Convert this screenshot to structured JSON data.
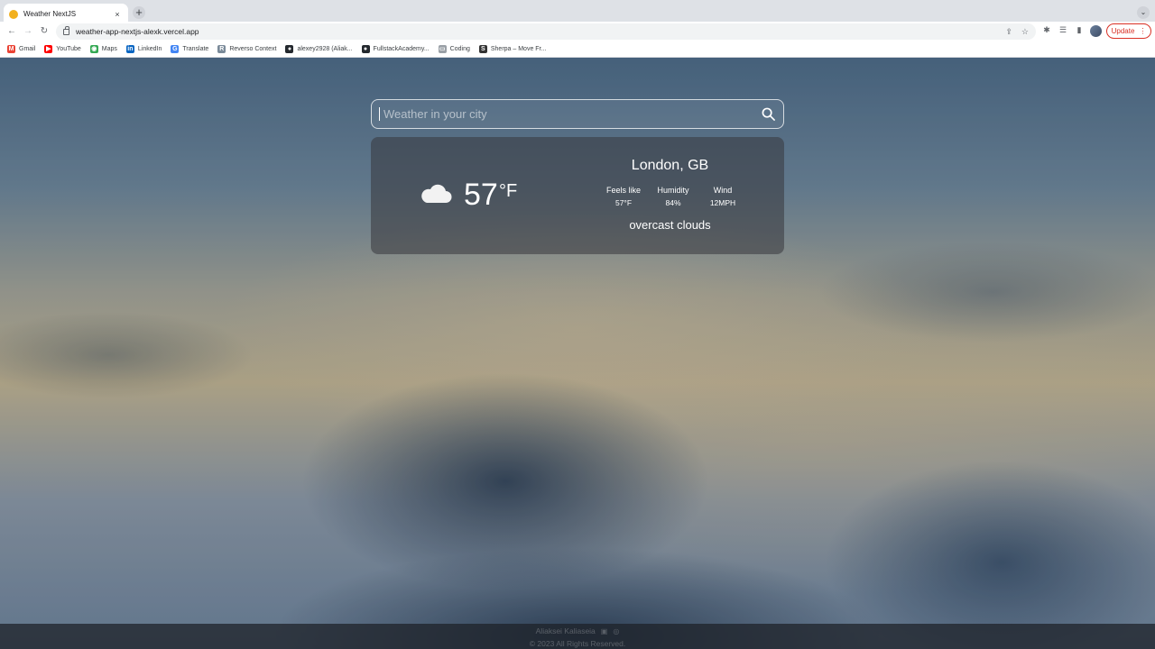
{
  "browser": {
    "tab_title": "Weather NextJS",
    "tab_close": "×",
    "new_tab": "+",
    "tab_menu": "⌄",
    "url": "weather-app-nextjs-alexk.vercel.app",
    "update_label": "Update",
    "update_menu": "⋮",
    "nav": {
      "back": "←",
      "forward": "→",
      "reload": "↻"
    },
    "omnibox_icons": {
      "share": "⇪",
      "star": "☆"
    },
    "toolbar_icons": {
      "extensions": "✱",
      "reading_list": "☰",
      "side_panel": "▮"
    },
    "bookmarks": [
      {
        "label": "Gmail",
        "icon": "M",
        "color": "#ea4335"
      },
      {
        "label": "YouTube",
        "icon": "▶",
        "color": "#ff0000"
      },
      {
        "label": "Maps",
        "icon": "◉",
        "color": "#34a853"
      },
      {
        "label": "LinkedIn",
        "icon": "in",
        "color": "#0a66c2"
      },
      {
        "label": "Translate",
        "icon": "G",
        "color": "#4285f4"
      },
      {
        "label": "Reverso Context",
        "icon": "R",
        "color": "#7a8a99"
      },
      {
        "label": "alexey2928 (Aliak...",
        "icon": "●",
        "color": "#24292e"
      },
      {
        "label": "FullstackAcademy...",
        "icon": "●",
        "color": "#24292e"
      },
      {
        "label": "Coding",
        "icon": "▭",
        "color": "#9aa0a6"
      },
      {
        "label": "Sherpa – Move Fr...",
        "icon": "S",
        "color": "#333333"
      }
    ]
  },
  "search": {
    "placeholder": "Weather in your city",
    "value": ""
  },
  "weather": {
    "icon": "cloud-icon",
    "temperature": "57",
    "unit": "°F",
    "city": "London, GB",
    "feels_like_label": "Feels like",
    "feels_like_value": "57°F",
    "humidity_label": "Humidity",
    "humidity_value": "84%",
    "wind_label": "Wind",
    "wind_value": "12MPH",
    "description": "overcast clouds"
  },
  "footer": {
    "author": "Aliaksei Kaliaseia",
    "linkedin_icon": "▣",
    "github_icon": "◎",
    "copyright": "© 2023 All Rights Reserved."
  }
}
